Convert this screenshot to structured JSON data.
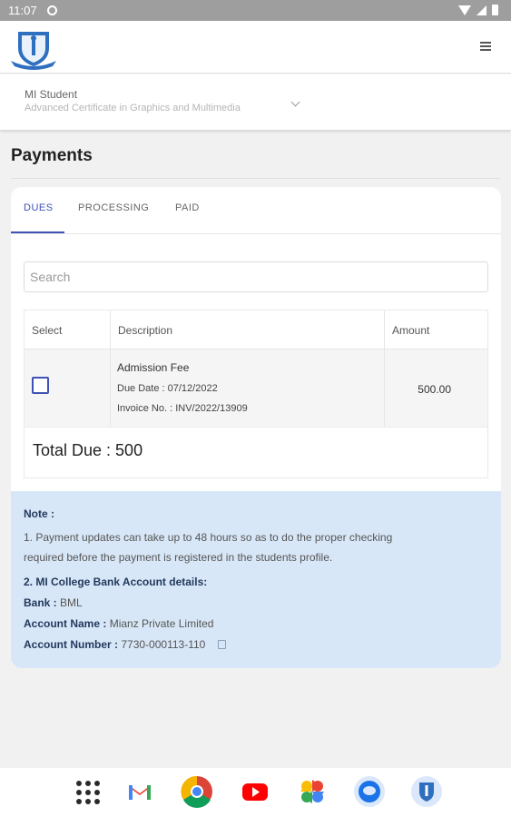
{
  "status_bar": {
    "time": "11:07"
  },
  "student": {
    "name": "MI Student",
    "course": "Advanced Certificate in Graphics and Multimedia"
  },
  "page_title": "Payments",
  "tabs": [
    {
      "label": "DUES",
      "active": true
    },
    {
      "label": "PROCESSING",
      "active": false
    },
    {
      "label": "PAID",
      "active": false
    }
  ],
  "search": {
    "placeholder": "Search",
    "value": ""
  },
  "table": {
    "headers": {
      "select": "Select",
      "description": "Description",
      "amount": "Amount"
    },
    "rows": [
      {
        "title": "Admission Fee",
        "due_date": "Due Date : 07/12/2022",
        "invoice": "Invoice No. : INV/2022/13909",
        "amount": "500.00",
        "selected": false
      }
    ],
    "total": "Total Due : 500"
  },
  "note": {
    "heading": "Note :",
    "line1": "1. Payment updates can take up to 48 hours so as to do the proper checking",
    "line2": "required before the payment is registered in the students profile.",
    "bank_heading": "2. MI College Bank Account details:",
    "bank_label": "Bank :",
    "bank_value": "BML",
    "account_name_label": "Account Name :",
    "account_name_value": "Mianz Private Limited",
    "account_number_label": "Account Number :",
    "account_number_value": "7730-000113-110"
  },
  "colors": {
    "accent": "#3f51b5",
    "note_bg": "#d8e7f7"
  }
}
